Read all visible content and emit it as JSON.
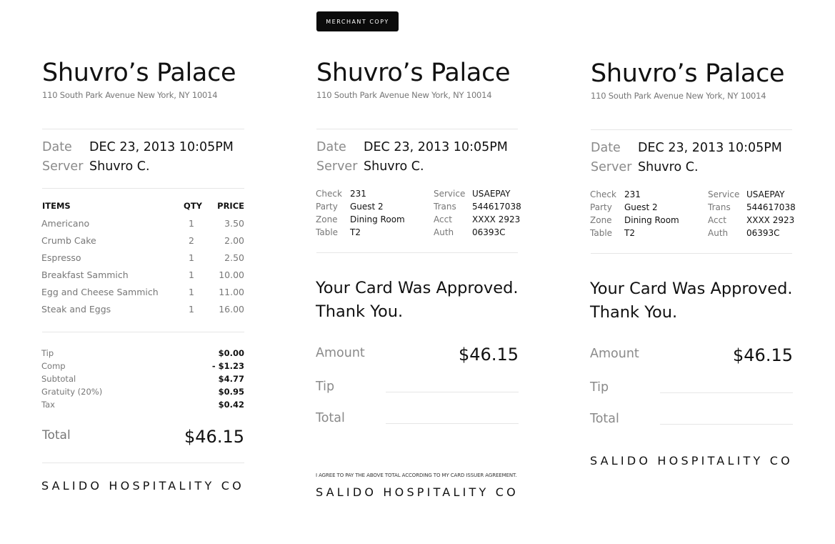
{
  "merchant_badge": "MERCHANT COPY",
  "restaurant": {
    "name": "Shuvro’s Palace",
    "address": "110 South Park Avenue New York, NY 10014"
  },
  "meta": {
    "date_label": "Date",
    "date_value": "DEC 23, 2013 10:05PM",
    "server_label": "Server",
    "server_value": "Shuvro C."
  },
  "items_table": {
    "headers": {
      "items": "ITEMS",
      "qty": "QTY",
      "price": "PRICE"
    },
    "rows": [
      {
        "name": "Americano",
        "qty": "1",
        "price": "3.50"
      },
      {
        "name": "Crumb Cake",
        "qty": "2",
        "price": "2.00"
      },
      {
        "name": "Espresso",
        "qty": "1",
        "price": "2.50"
      },
      {
        "name": "Breakfast Sammich",
        "qty": "1",
        "price": "10.00"
      },
      {
        "name": "Egg and Cheese Sammich",
        "qty": "1",
        "price": "11.00"
      },
      {
        "name": "Steak and Eggs",
        "qty": "1",
        "price": "16.00"
      }
    ]
  },
  "summary": [
    {
      "label": "Tip",
      "value": "$0.00"
    },
    {
      "label": "Comp",
      "value": "- $1.23"
    },
    {
      "label": "Subtotal",
      "value": "$4.77"
    },
    {
      "label": "Gratuity (20%)",
      "value": "$0.95"
    },
    {
      "label": "Tax",
      "value": "$0.42"
    }
  ],
  "total": {
    "label": "Total",
    "value": "$46.15"
  },
  "details": {
    "left": [
      {
        "label": "Check",
        "value": "231"
      },
      {
        "label": "Party",
        "value": "Guest 2"
      },
      {
        "label": "Zone",
        "value": "Dining Room"
      },
      {
        "label": "Table",
        "value": "T2"
      }
    ],
    "right": [
      {
        "label": "Service",
        "value": "USAEPAY"
      },
      {
        "label": "Trans",
        "value": "544617038"
      },
      {
        "label": "Acct",
        "value": "XXXX 2923"
      },
      {
        "label": "Auth",
        "value": "06393C"
      }
    ]
  },
  "approval": {
    "line1": "Your Card Was Approved.",
    "line2": "Thank You."
  },
  "payment": {
    "amount_label": "Amount",
    "amount_value": "$46.15",
    "tip_label": "Tip",
    "total_label": "Total"
  },
  "agreement": "I AGREE TO PAY THE ABOVE TOTAL ACCORDING TO MY CARD ISSUER AGREEMENT.",
  "brand": "SALIDO HOSPITALITY CO"
}
